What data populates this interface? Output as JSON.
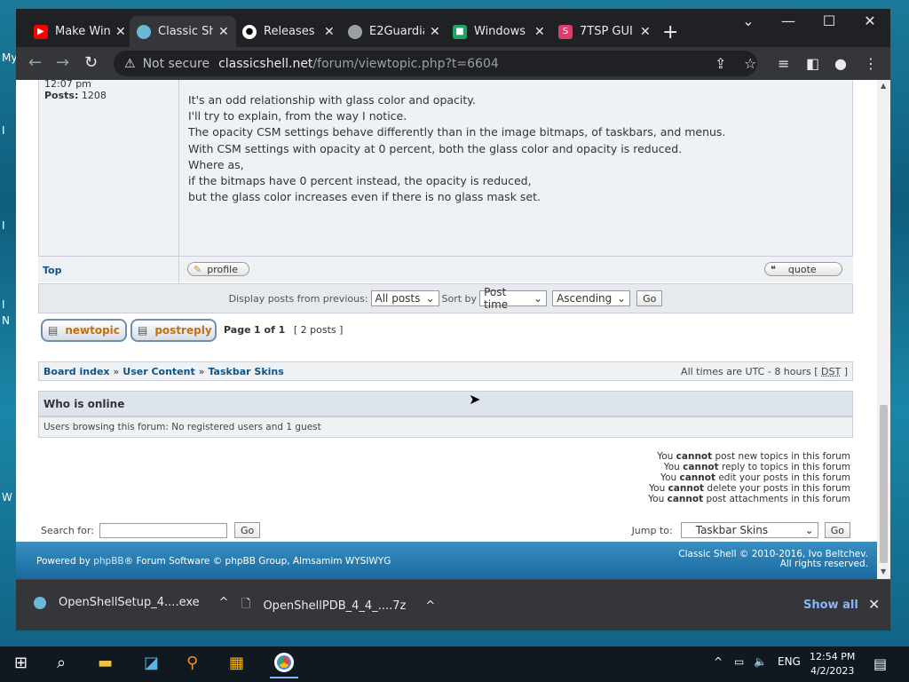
{
  "desktop": {
    "fragments": [
      "My",
      "I",
      "I",
      "I",
      "N",
      "W"
    ]
  },
  "tabs": [
    {
      "title": "Make Win",
      "icon": "youtube-icon",
      "color": "#ff0000"
    },
    {
      "title": "Classic Sh",
      "icon": "classic-shell-icon",
      "color": "#6ab7d6",
      "active": true
    },
    {
      "title": "Releases",
      "icon": "github-icon",
      "color": "#ffffff"
    },
    {
      "title": "E2Guardia",
      "icon": "globe-icon",
      "color": "#9aa0a6"
    },
    {
      "title": "Windows",
      "icon": "green-app-icon",
      "color": "#1fa463"
    },
    {
      "title": "7TSP GUI",
      "icon": "sp-icon",
      "color": "#d93f6a"
    }
  ],
  "address": {
    "warning": "Not secure",
    "host": "classicshell.net",
    "path": "/forum/viewtopic.php?t=6604"
  },
  "post": {
    "time": "12:07 pm",
    "posts_label": "Posts:",
    "posts_count": "1208",
    "lines": [
      "It's an odd relationship with glass color and opacity.",
      "I'll try to explain, from the way I notice.",
      "",
      "The opacity CSM settings behave differently than in the image bitmaps, of taskbars, and menus.",
      "With CSM settings with opacity at 0 percent, both the glass color and opacity is reduced.",
      "Where as,",
      "if the bitmaps have 0 percent instead, the opacity is reduced,",
      "but the glass color increases even if there is no glass mask set."
    ],
    "top_link": "Top",
    "profile_btn": "profile",
    "quote_btn": "quote"
  },
  "sortbar": {
    "display_label": "Display posts from previous:",
    "display_value": "All posts",
    "sort_label": "Sort by",
    "sort_value": "Post time",
    "order_value": "Ascending",
    "go": "Go"
  },
  "actions": {
    "newtopic": "newtopic",
    "postreply": "postreply",
    "page_prefix": "Page",
    "page_current": "1 of 1",
    "posts_count": "[ 2 posts ]"
  },
  "breadcrumb": {
    "items": [
      "Board index",
      "User Content",
      "Taskbar Skins"
    ],
    "sep": "»",
    "times": "All times are UTC - 8 hours [",
    "dst": "DST",
    "times_end": "]"
  },
  "online": {
    "title": "Who is online",
    "text": "Users browsing this forum: No registered users and 1 guest"
  },
  "permissions": [
    {
      "pre": "You",
      "bold": "cannot",
      "post": "post new topics in this forum"
    },
    {
      "pre": "You",
      "bold": "cannot",
      "post": "reply to topics in this forum"
    },
    {
      "pre": "You",
      "bold": "cannot",
      "post": "edit your posts in this forum"
    },
    {
      "pre": "You",
      "bold": "cannot",
      "post": "delete your posts in this forum"
    },
    {
      "pre": "You",
      "bold": "cannot",
      "post": "post attachments in this forum"
    }
  ],
  "search": {
    "label": "Search for:",
    "go": "Go",
    "jump_label": "Jump to:",
    "jump_value": "Taskbar Skins"
  },
  "footer": {
    "left_pre": "Powered by",
    "phpbb": "phpBB",
    "left_post": "® Forum Software © phpBB Group, Almsamim WYSIWYG",
    "right1": "Classic Shell © 2010-2016, Ivo Beltchev.",
    "right2": "All rights reserved."
  },
  "downloads": [
    {
      "name": "OpenShellSetup_4....exe"
    },
    {
      "name": "OpenShellPDB_4_4_....7z"
    }
  ],
  "download_show_all": "Show all",
  "tray": {
    "lang": "ENG",
    "time": "12:54 PM",
    "date": "4/2/2023"
  }
}
